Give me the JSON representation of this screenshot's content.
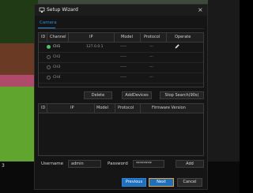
{
  "dialog": {
    "title": "Setup Wizard",
    "close_icon": "×"
  },
  "tabs": [
    {
      "label": "Camera"
    }
  ],
  "camera_table": {
    "headers": [
      "ID",
      "Channel",
      "IP",
      "Model",
      "Protocol",
      "Operate"
    ],
    "rows": [
      {
        "selected": true,
        "channel": "CH1",
        "ip": "127.0.0.1",
        "model": "-----",
        "protocol": "---"
      },
      {
        "selected": false,
        "channel": "CH2",
        "ip": "",
        "model": "-----",
        "protocol": "---"
      },
      {
        "selected": false,
        "channel": "CH3",
        "ip": "",
        "model": "-----",
        "protocol": "---"
      },
      {
        "selected": false,
        "channel": "CH4",
        "ip": "",
        "model": "-----",
        "protocol": "---"
      }
    ]
  },
  "actions": {
    "delete": "Delete",
    "add_devices": "AddDevices",
    "stop_search": "Stop Search(90s)"
  },
  "search_table": {
    "headers": [
      "ID",
      "IP",
      "Model",
      "Protocol",
      "Firmware Version"
    ]
  },
  "credentials": {
    "username_label": "Username",
    "username_value": "admin",
    "password_label": "Password",
    "password_value": "********",
    "add": "Add"
  },
  "footer": {
    "previous": "Previous",
    "next": "Next",
    "cancel": "Cancel"
  },
  "background": {
    "left_text": "",
    "bottom_text": "3",
    "right_text": ""
  },
  "colors": {
    "accent": "#2e8fd8",
    "selected": "#4fc26a",
    "focus": "#f0a030"
  }
}
